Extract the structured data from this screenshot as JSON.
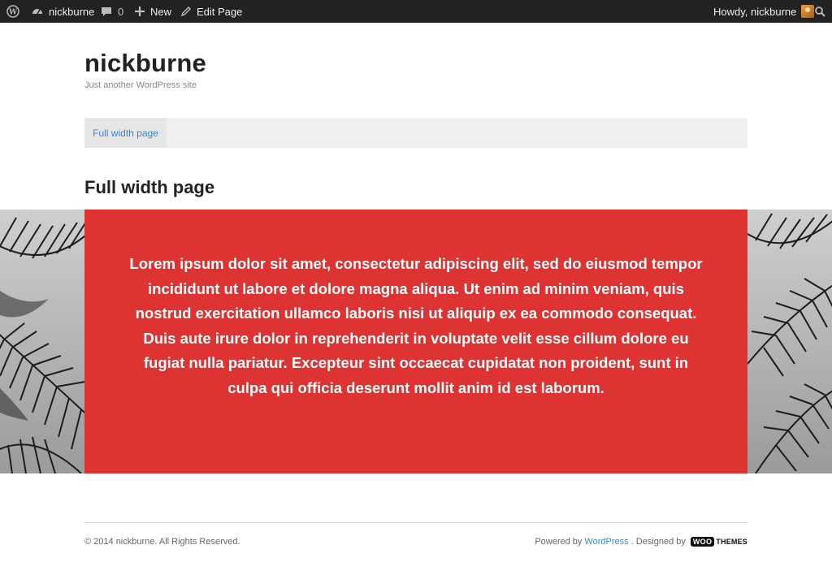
{
  "admin_bar": {
    "site_name": "nickburne",
    "comments_count": "0",
    "new_label": "New",
    "edit_label": "Edit Page",
    "howdy": "Howdy, nickburne",
    "icons": [
      "wordpress-icon",
      "dashboard-icon",
      "comment-icon",
      "plus-icon",
      "pencil-icon",
      "search-icon"
    ]
  },
  "header": {
    "title": "nickburne",
    "tagline": "Just another WordPress site"
  },
  "nav": {
    "items": [
      {
        "label": "Full width page"
      }
    ]
  },
  "page": {
    "title": "Full width page",
    "hero_text": "Lorem ipsum dolor sit amet, consectetur adipiscing elit, sed do eiusmod tempor incididunt ut labore et dolore magna aliqua. Ut enim ad minim veniam, quis nostrud exercitation ullamco laboris nisi ut aliquip ex ea commodo consequat. Duis aute irure dolor in reprehenderit in voluptate velit esse cillum dolore eu fugiat nulla pariatur. Excepteur sint occaecat cupidatat non proident, sunt in culpa qui officia deserunt mollit anim id est laborum."
  },
  "footer": {
    "copyright": "© 2014 nickburne. All Rights Reserved.",
    "powered_by": "Powered by",
    "wordpress_link": "WordPress",
    "designed_by": ". Designed by",
    "woo_badge": "WOO",
    "woo_themes": "THEMES"
  },
  "colors": {
    "admin_bar_bg": "#222222",
    "accent_red": "#dd3333",
    "link_blue": "#3a86c9",
    "nav_bg": "#efefef"
  }
}
